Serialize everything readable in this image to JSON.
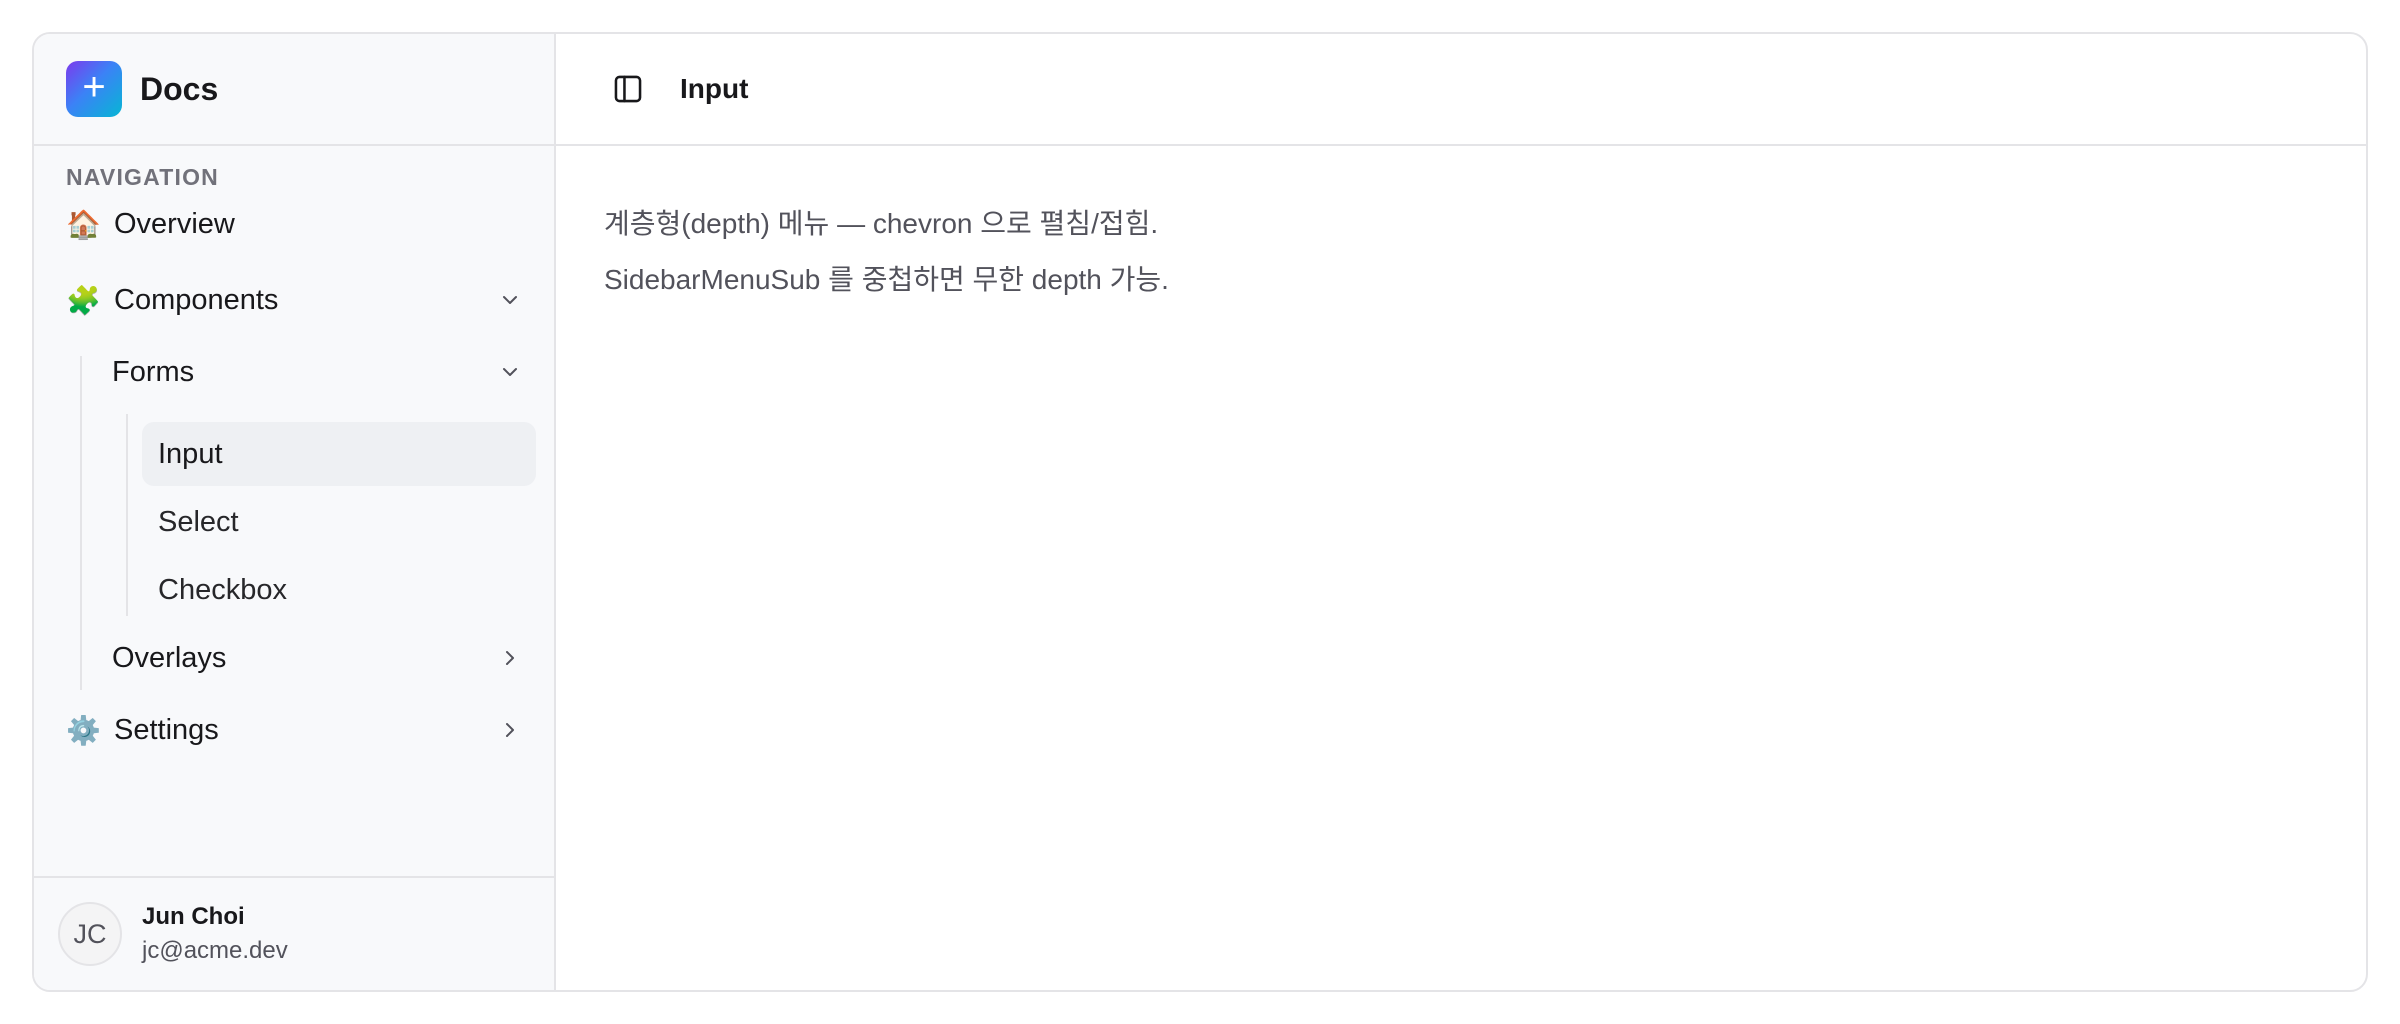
{
  "sidebar": {
    "brand": {
      "logo_glyph": "+",
      "name": "Docs"
    },
    "group_label": "NAVIGATION",
    "items": [
      {
        "emoji": "🏠",
        "label": "Overview"
      },
      {
        "emoji": "🧩",
        "label": "Components"
      },
      {
        "emoji": "⚙️",
        "label": "Settings"
      }
    ],
    "components_sub": [
      {
        "label": "Forms"
      },
      {
        "label": "Overlays"
      }
    ],
    "forms_sub": [
      {
        "label": "Input",
        "active": true
      },
      {
        "label": "Select"
      },
      {
        "label": "Checkbox"
      }
    ],
    "user": {
      "initials": "JC",
      "name": "Jun Choi",
      "email": "jc@acme.dev"
    }
  },
  "main": {
    "title": "Input",
    "paragraphs": [
      "계층형(depth) 메뉴 — chevron 으로 펼침/접힘.",
      "SidebarMenuSub 를 중첩하면 무한 depth 가능."
    ]
  },
  "icons": {
    "toggle": "sidebar-toggle-icon",
    "expanded": "chevron-down-icon",
    "collapsed": "chevron-right-icon"
  },
  "colors": {
    "sidebar_bg": "#f8f9fb",
    "active_bg": "#eef0f3",
    "border": "#e4e4e7",
    "logo_gradient": [
      "#7c3aed",
      "#3b82f6",
      "#06b6d4"
    ]
  }
}
